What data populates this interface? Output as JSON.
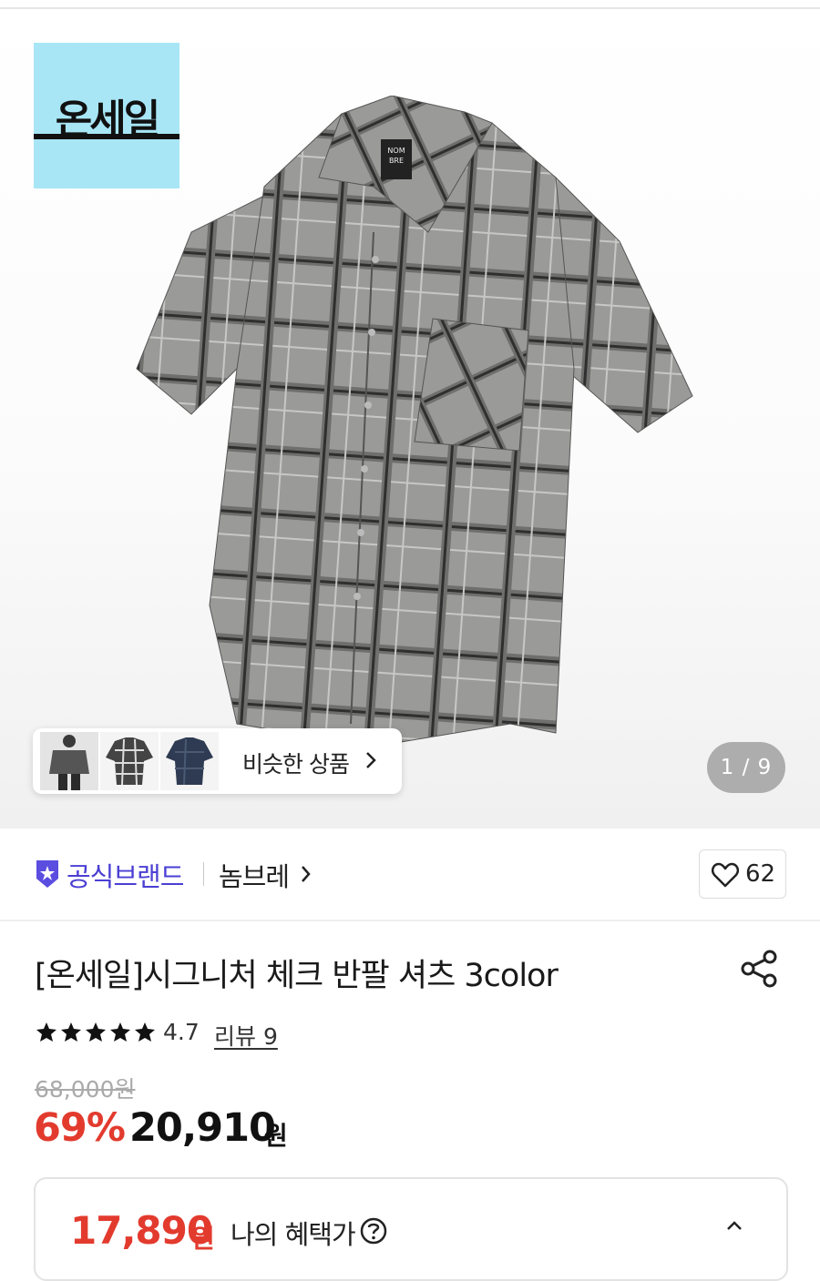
{
  "hero": {
    "badge_text": "온세일",
    "shirt_brand_tag": "NOM BRE",
    "similar_label": "비슷한 상품",
    "pager": "1 / 9"
  },
  "brand": {
    "official_label": "공식브랜드",
    "name": "놈브레",
    "like_count": "62"
  },
  "product": {
    "title": "[온세일]시그니처 체크 반팔 셔츠 3color",
    "rating": "4.7",
    "review_label": "리뷰 9",
    "original_price": "68,000원",
    "discount": "69%",
    "price": "20,910",
    "price_unit": "원"
  },
  "benefit": {
    "price": "17,890",
    "price_unit": "원",
    "label": "나의 혜택가"
  },
  "colors": {
    "accent_red": "#e23b2e",
    "brand_purple": "#4a3fd3",
    "badge_bg": "#a8e6f6"
  },
  "icons": [
    "shield-star-icon",
    "chevron-right-icon",
    "heart-icon",
    "share-icon",
    "star-icon",
    "help-icon",
    "chevron-up-icon"
  ]
}
